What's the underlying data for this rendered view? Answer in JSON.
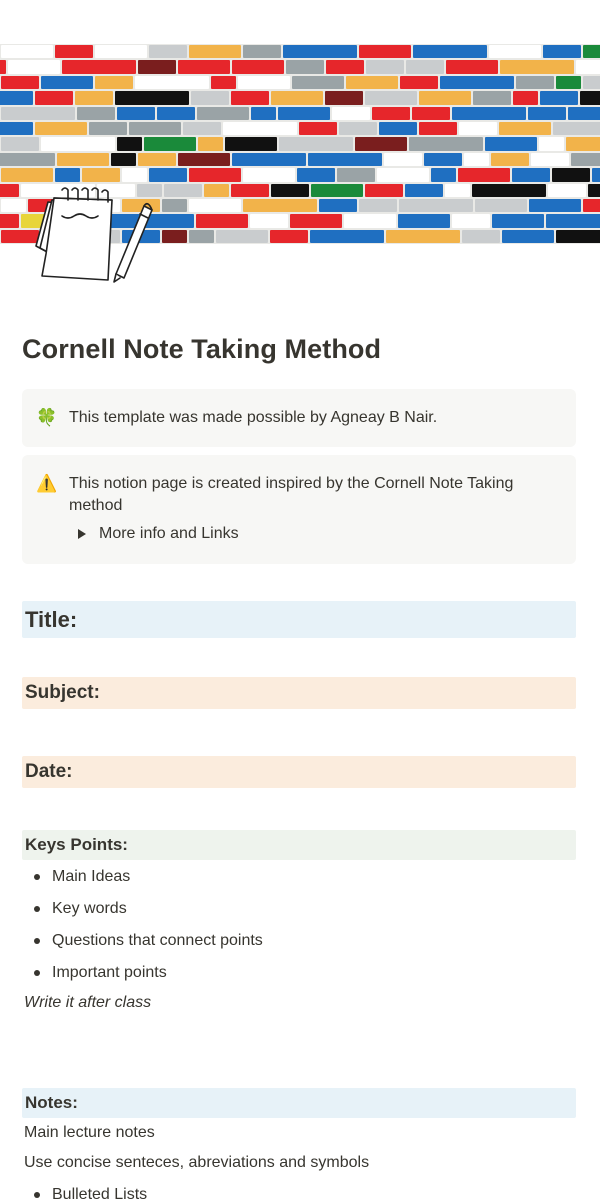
{
  "colors": {
    "cover_palette": [
      "#1f6fc1",
      "#e6262b",
      "#f2b34a",
      "#ffffff",
      "#111111",
      "#9aa3a6",
      "#c9ccce",
      "#1a8a3a",
      "#e8d53a",
      "#7a1e1e"
    ],
    "callout_bg": "#f7f7f5",
    "heading_blue_bg": "#e7f2f8",
    "heading_orange_bg": "#fbecdd",
    "heading_green_bg": "#eef3ed",
    "text": "#37352f"
  },
  "cover": {
    "description_icon": "notepad-pencil-icon"
  },
  "page": {
    "title": "Cornell Note Taking Method"
  },
  "callouts": [
    {
      "icon": "four-leaf-clover-icon",
      "emoji": "🍀",
      "text": "This template was made possible by Agneay B Nair."
    },
    {
      "icon": "warning-icon",
      "emoji": "⚠️",
      "text": "This notion page is created inspired by the Cornell Note Taking method",
      "toggle_label": "More info and Links"
    }
  ],
  "sections": {
    "title_label": "Title:",
    "subject_label": "Subject:",
    "date_label": "Date:",
    "keypoints_label": "Keys Points:",
    "keypoints_items": [
      "Main Ideas",
      "Key words",
      "Questions that connect points",
      "Important points"
    ],
    "keypoints_note": "Write it after class",
    "notes_label": "Notes:",
    "notes_lines": [
      "Main lecture notes",
      "Use concise senteces, abreviations and symbols"
    ],
    "notes_items": [
      "Bulleted Lists"
    ]
  }
}
